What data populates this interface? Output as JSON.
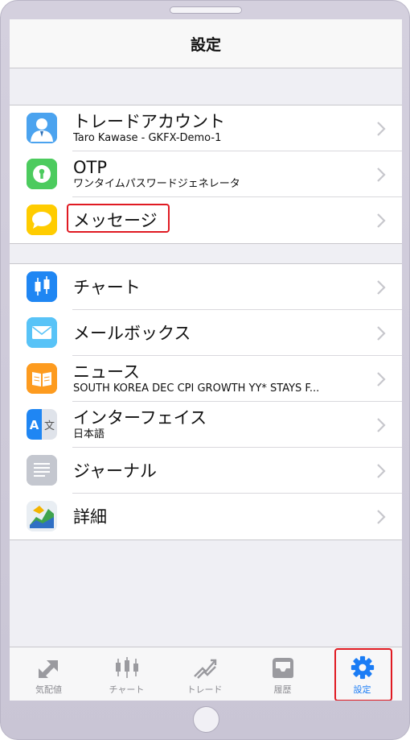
{
  "navbar": {
    "title": "設定"
  },
  "group1": [
    {
      "title": "トレードアカウント",
      "subtitle": "Taro Kawase - GKFX-Demo-1",
      "icon": "account-icon"
    },
    {
      "title": "OTP",
      "subtitle": "ワンタイムパスワードジェネレータ",
      "icon": "otp-key-icon"
    },
    {
      "title": "メッセージ",
      "icon": "message-bubble-icon"
    }
  ],
  "group2": [
    {
      "title": "チャート",
      "icon": "candlestick-chart-icon"
    },
    {
      "title": "メールボックス",
      "icon": "mail-envelope-icon"
    },
    {
      "title": "ニュース",
      "subtitle": "SOUTH KOREA DEC CPI GROWTH YY* STAYS F...",
      "icon": "news-book-icon"
    },
    {
      "title": "インターフェイス",
      "subtitle": "日本語",
      "icon": "language-icon"
    },
    {
      "title": "ジャーナル",
      "icon": "journal-lines-icon"
    },
    {
      "title": "詳細",
      "icon": "metatrader-logo-icon"
    }
  ],
  "tabs": [
    {
      "label": "気配値",
      "icon": "quotes-arrows-icon"
    },
    {
      "label": "チャート",
      "icon": "chart-candles-icon"
    },
    {
      "label": "トレード",
      "icon": "trade-trend-icon"
    },
    {
      "label": "履歴",
      "icon": "history-tray-icon"
    },
    {
      "label": "設定",
      "icon": "settings-gear-icon"
    }
  ],
  "colors": {
    "accent": "#1a7cf5",
    "highlight": "#e01a22",
    "inactive_tab": "#8e8e93"
  }
}
